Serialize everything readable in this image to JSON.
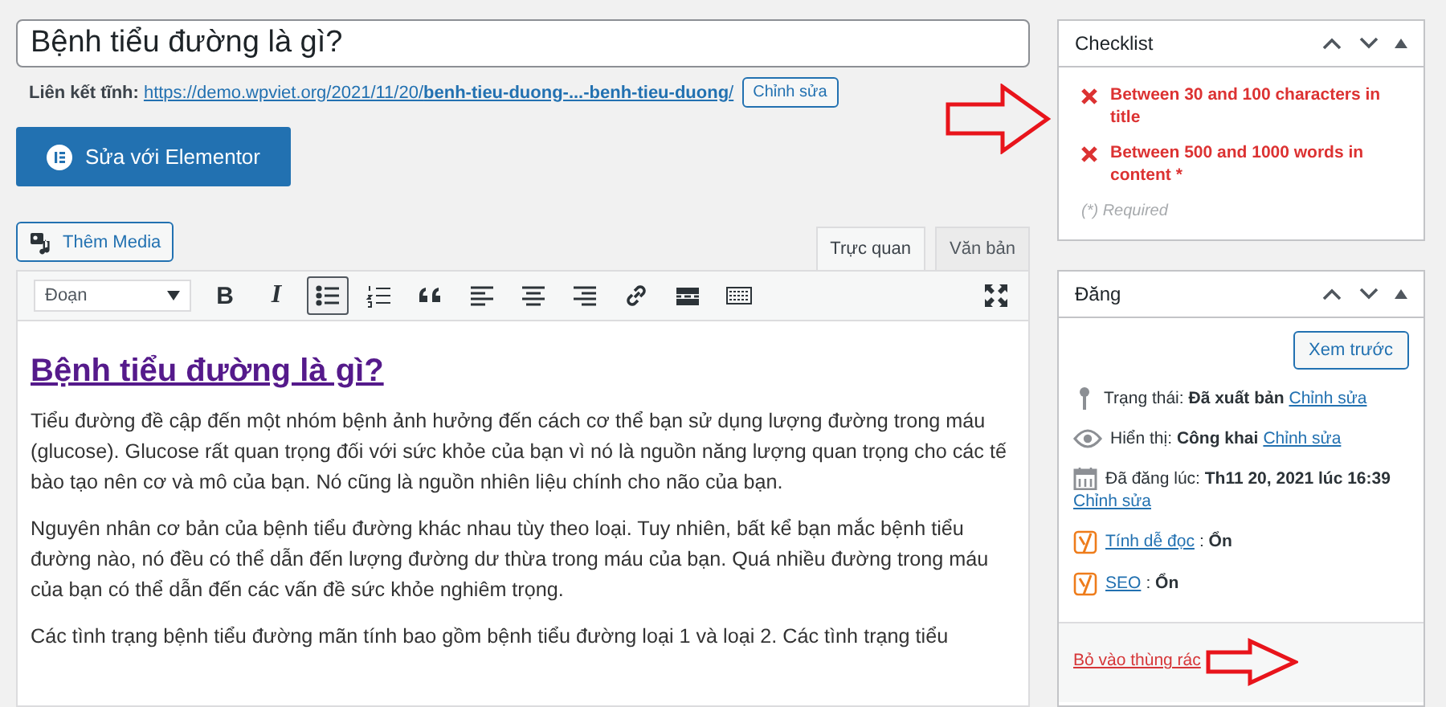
{
  "title_field": {
    "value": "Bệnh tiểu đường là gì?"
  },
  "permalink": {
    "label": "Liên kết tĩnh:",
    "url": "https://demo.wpviet.org/2021/11/20/**benh-tieu-duong-...-benh-tieu-duong**/",
    "edit_button": "Chỉnh sửa"
  },
  "elementor_button": "Sửa với Elementor",
  "add_media_button": "Thêm Media",
  "editor_tabs": [
    {
      "label": "Trực quan",
      "selected": true
    },
    {
      "label": "Văn bản",
      "selected": false
    }
  ],
  "toolbar": {
    "format": "Đoạn",
    "buttons": [
      {
        "kind": "bold",
        "label": "B",
        "active": false
      },
      {
        "kind": "italic",
        "label": "I",
        "active": false
      },
      {
        "kind": "bullet-list",
        "active": true
      },
      {
        "kind": "numbered-list",
        "active": false
      },
      {
        "kind": "quote",
        "active": false
      },
      {
        "kind": "align-left",
        "active": false
      },
      {
        "kind": "align-center",
        "active": false
      },
      {
        "kind": "align-right",
        "active": false
      },
      {
        "kind": "link",
        "active": false
      },
      {
        "kind": "read-more",
        "active": false
      },
      {
        "kind": "toolbar-toggle",
        "active": false
      }
    ]
  },
  "content": {
    "heading": "Bệnh tiểu đường là gì?",
    "paragraphs": [
      "Tiểu đường đề cập đến một nhóm bệnh ảnh hưởng đến cách cơ thể bạn sử dụng lượng đường trong máu (glucose). Glucose rất quan trọng đối với sức khỏe của bạn vì nó là nguồn năng lượng quan trọng cho các tế bào tạo nên cơ và mô của bạn. Nó cũng là nguồn nhiên liệu chính cho não của bạn.",
      "Nguyên nhân cơ bản của bệnh tiểu đường khác nhau tùy theo loại. Tuy nhiên, bất kể bạn mắc bệnh tiểu đường nào, nó đều có thể dẫn đến lượng đường dư thừa trong máu của bạn. Quá nhiều đường trong máu của bạn có thể dẫn đến các vấn đề sức khỏe nghiêm trọng.",
      "Các tình trạng bệnh tiểu đường mãn tính bao gồm bệnh tiểu đường loại 1 và loại 2. Các tình trạng tiểu"
    ]
  },
  "checklist": {
    "title": "Checklist",
    "items": [
      {
        "text": "Between 30 and 100 characters in title",
        "passed": false
      },
      {
        "text": "Between 500 and 1000 words in content *",
        "passed": false
      }
    ],
    "note": "(*) Required"
  },
  "publish": {
    "title": "Đăng",
    "preview_button": "Xem trước",
    "rows": [
      {
        "kind": "status",
        "label": "Trạng thái:",
        "value": "Đã xuất bản",
        "link": "Chỉnh sửa"
      },
      {
        "kind": "visibility",
        "label": "Hiển thị:",
        "value": "Công khai",
        "link": "Chỉnh sửa"
      },
      {
        "kind": "date",
        "label": "Đã đăng lúc:",
        "value": "Th11 20, 2021 lúc 16:39",
        "link": "Chỉnh sửa"
      },
      {
        "kind": "readability",
        "link": "Tính dễ đọc",
        "separator": ":",
        "value": "Ổn"
      },
      {
        "kind": "seo",
        "link": "SEO",
        "separator": ":",
        "value": "Ổn"
      }
    ],
    "trash_link": "Bỏ vào thùng rác"
  }
}
